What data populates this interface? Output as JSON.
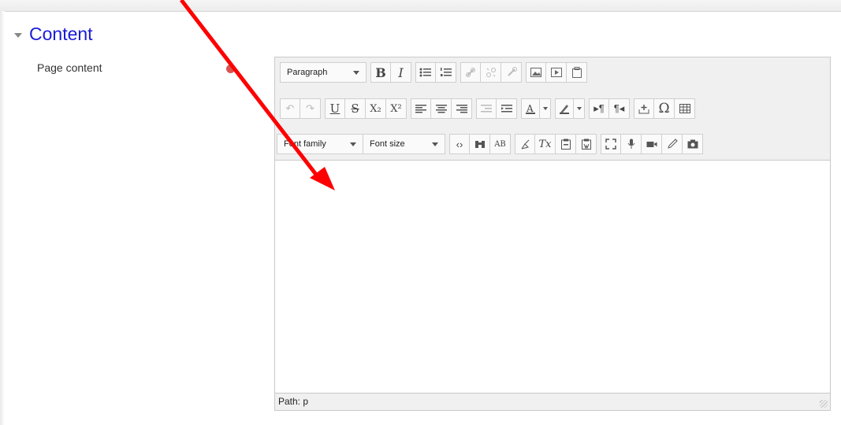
{
  "section": {
    "title": "Content"
  },
  "field": {
    "label": "Page content"
  },
  "toolbar": {
    "paragraph": "Paragraph",
    "bold": "B",
    "italic": "I",
    "underline": "U",
    "strike": "S",
    "sub": "X₂",
    "sup": "X²",
    "font_family": "Font family",
    "font_size": "Font size",
    "omega": "Ω",
    "clear_format": "Tx",
    "ab": "AB"
  },
  "status": {
    "path": "Path: p"
  },
  "colors": {
    "accent": "#1b1bd6",
    "required": "#d9534f",
    "arrow": "#ff0000"
  }
}
